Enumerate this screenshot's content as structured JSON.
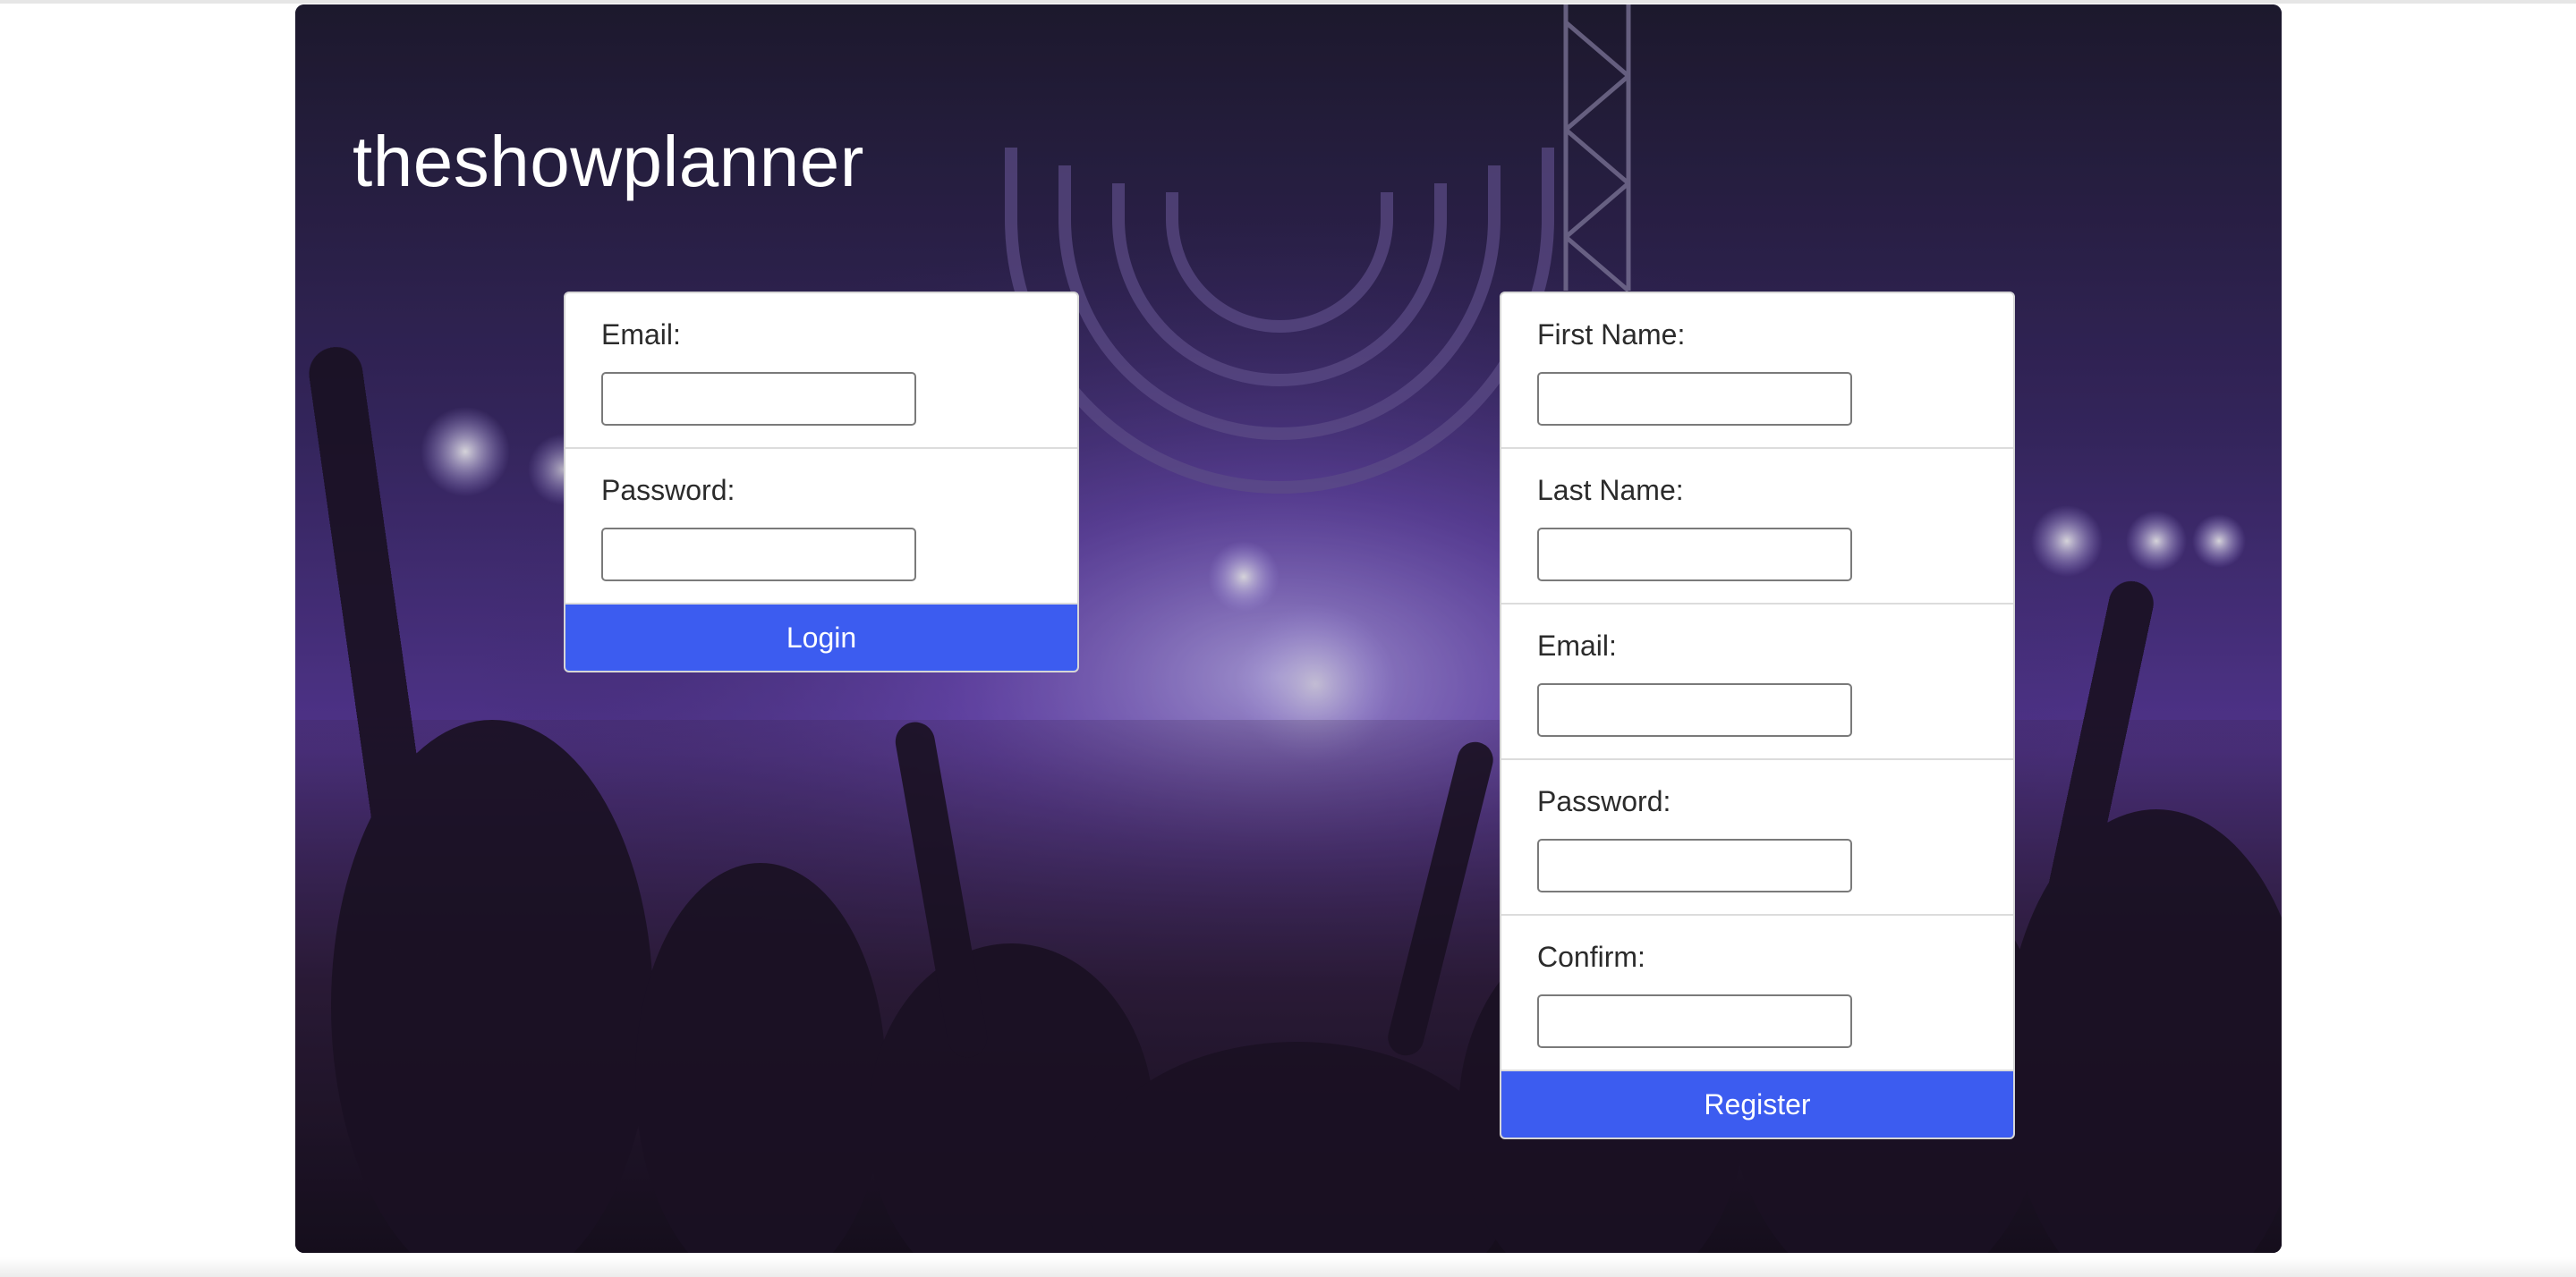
{
  "header": {
    "title": "theshowplanner"
  },
  "login": {
    "fields": [
      {
        "label": "Email:",
        "value": ""
      },
      {
        "label": "Password:",
        "value": ""
      }
    ],
    "button": "Login"
  },
  "register": {
    "fields": [
      {
        "label": "First Name:",
        "value": ""
      },
      {
        "label": "Last Name:",
        "value": ""
      },
      {
        "label": "Email:",
        "value": ""
      },
      {
        "label": "Password:",
        "value": ""
      },
      {
        "label": "Confirm:",
        "value": ""
      }
    ],
    "button": "Register"
  },
  "colors": {
    "accent": "#3c5cf0",
    "hero_dark": "#1a1530",
    "hero_purple": "#6a3fb8"
  }
}
